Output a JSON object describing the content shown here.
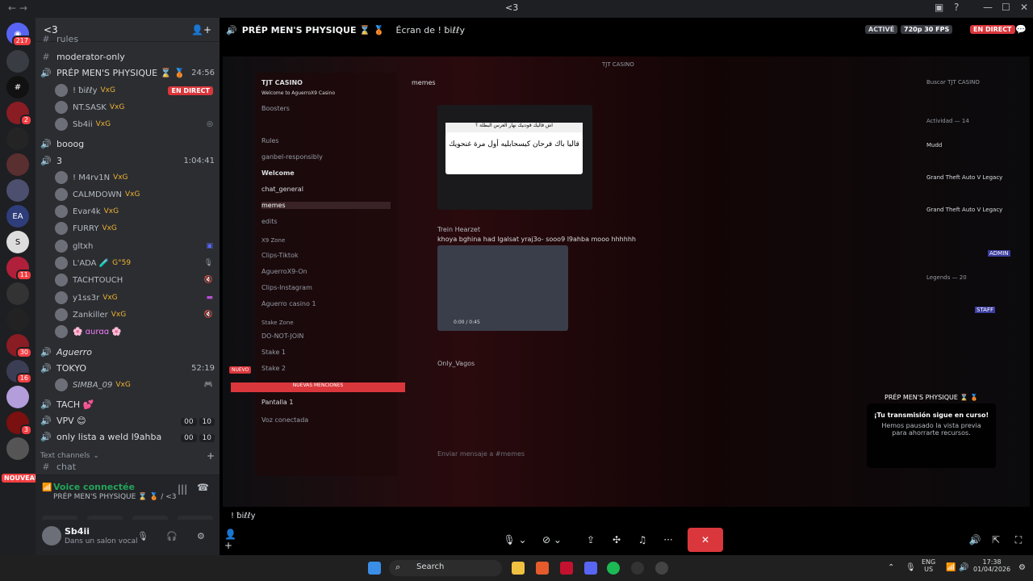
{
  "window": {
    "title": "<3"
  },
  "guilds": {
    "dm_badge": "217",
    "badges": [
      "2",
      "11",
      "30",
      "16",
      "3"
    ],
    "new_label": "NOUVEAU"
  },
  "server": {
    "name": "<3",
    "channels": {
      "partial_top": "rules",
      "moderator_only": "moderator-only",
      "prep": "PRÉP MEN'S PHYSIQUE ⌛ 🥉",
      "prep_time": "24:56",
      "booog": "booog",
      "three": "3",
      "three_time": "1:04:41",
      "aguerro": "Aguerro",
      "tokyo": "TOKYO",
      "tokyo_time": "52:19",
      "tach": "TACH 💕",
      "vpv": "VPV 😊",
      "vpv_a": "00",
      "vpv_b": "10",
      "only_lista": "only lista a weld l9ahba",
      "ol_a": "00",
      "ol_b": "10",
      "text_channels": "Text channels",
      "chat": "chat"
    },
    "prep_users": [
      {
        "name": "! ƀiℓℓy",
        "tag": "VxG",
        "live": "EN DIRECT"
      },
      {
        "name": "NT.SASK",
        "tag": "VxG"
      },
      {
        "name": "Sb4ii",
        "tag": "VxG"
      }
    ],
    "three_users": [
      {
        "name": "! M4rv1N",
        "tag": "VxG"
      },
      {
        "name": "CALMDOWN",
        "tag": "VxG"
      },
      {
        "name": "Evar4k",
        "tag": "VxG"
      },
      {
        "name": "FURRY",
        "tag": "VxG"
      },
      {
        "name": "gltxh",
        "tag": ""
      },
      {
        "name": "L'ADA 🧪",
        "tag": "G°59"
      },
      {
        "name": "TACHTOUCH",
        "tag": ""
      },
      {
        "name": "y1ss3r",
        "tag": "VxG"
      },
      {
        "name": "Zankiller",
        "tag": "VxG"
      },
      {
        "name": "🌸 ɑurɑɑ 🌸",
        "tag": ""
      }
    ],
    "tokyo_user": {
      "name": "SIMBA_09",
      "tag": "VxG"
    }
  },
  "voice_panel": {
    "status": "Voice connectée",
    "channel": "PRÉP MEN'S PHYSIQUE ⌛ 🥉 / <3"
  },
  "user_panel": {
    "name": "Sb4ii",
    "status": "Dans un salon vocal"
  },
  "stream": {
    "channel_title": "PRÉP MEN'S PHYSIQUE ⌛ 🥉",
    "screen_of": "Écran de ! ƀiℓℓy",
    "active": "ACTIVÉ",
    "quality": "720p 30 FPS",
    "live": "EN DIRECT",
    "streamer": "! ƀiℓℓy"
  },
  "inner": {
    "window_title": "TJT CASINO",
    "server_name": "TJT CASINO",
    "welcome": "Welcome to AguerroX9 Casino",
    "channel_list": [
      "Boosters",
      "Rules",
      "ganbel-responsibly",
      "Welcome",
      "chat_general",
      "memes",
      "edits",
      "X9 Zone",
      "Clips-Tiktok",
      "AguerroX9-On",
      "Clips-Instagram",
      "Aguerro casino 1",
      "Stake Zone",
      "DO-NOT-JOIN",
      "Stake 1",
      "Stake 2"
    ],
    "new_mentions": "NUEVAS MENCIONES",
    "nuevo": "NUEVO",
    "pantalla": "Pantalla 1",
    "voz": "Voz conectada",
    "current_channel": "memes",
    "msg1_text_a": "اش قاليك قودنيك نهار العرس البطلة ؟",
    "msg1_text_b": "قاليا باك فرحان كيسحابليه أول مرة غنحويك",
    "msg2_author": "Trein Hearzet",
    "msg2_text": "khoya bghina had lgalsat yraj3o- sooo9 l9ahba mooo hhhhhh",
    "msg2_time": "0:00 / 0:45",
    "msg3_author": "Only_Vagos",
    "input_placeholder": "Enviar mensaje a #memes",
    "search_placeholder": "Buscar TJT CASINO",
    "activity": "Actividad — 14",
    "activity_items": [
      "Mudd",
      "Grand Theft Auto V Legacy",
      "Grand Theft Auto V Legacy"
    ],
    "legends": "Legends — 20",
    "overlay_title": "PRÉP MEN'S PHYSIQUE ⌛ 🥉",
    "overlay_heading": "¡Tu transmisión sigue en curso!",
    "overlay_body": "Hemos pausado la vista previa para ahorrarte recursos.",
    "staff": "STAFF",
    "admin": "ADMIN"
  },
  "taskbar": {
    "search": "Search",
    "lang1": "ENG",
    "lang2": "US",
    "time": "17:38",
    "date": "01/04/2026"
  },
  "colors": {
    "discord_bg": "#2b2d31",
    "live_red": "#da373c",
    "online_green": "#23a55a"
  }
}
